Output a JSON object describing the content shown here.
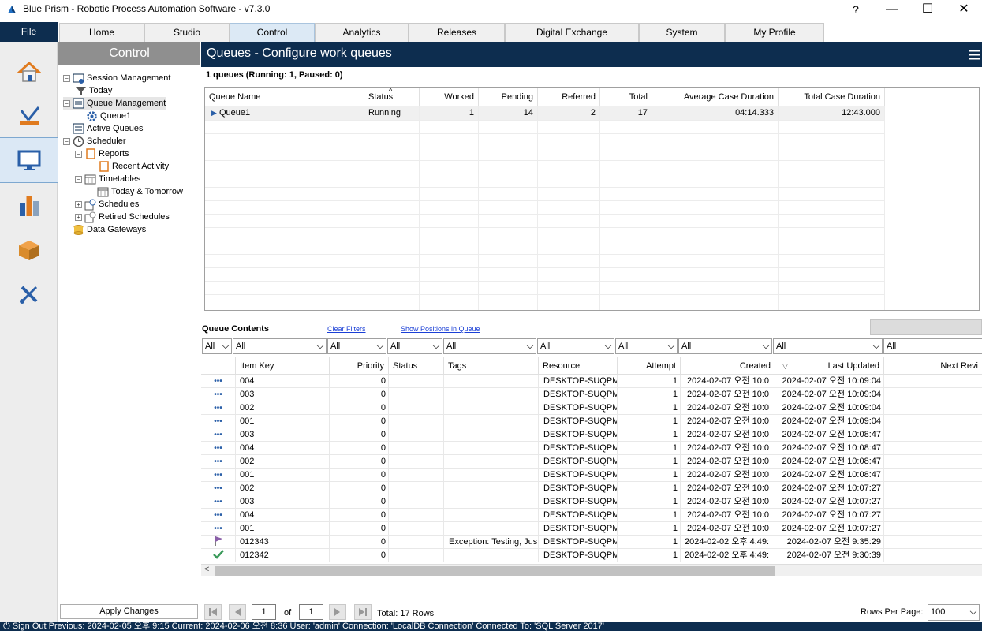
{
  "window": {
    "title": "Blue Prism - Robotic Process Automation Software - v7.3.0",
    "help": "?",
    "minimize": "—",
    "maximize": "☐",
    "close": "✕"
  },
  "menu": {
    "file": "File",
    "tabs": [
      "Home",
      "Studio",
      "Control",
      "Analytics",
      "Releases",
      "Digital Exchange",
      "System",
      "My Profile"
    ],
    "active_tab": "Control"
  },
  "iconbar": {
    "items": [
      "home-icon",
      "studio-icon",
      "control-icon",
      "analytics-icon",
      "releases-icon",
      "system-icon"
    ],
    "active": "control-icon"
  },
  "nav": {
    "title": "Control",
    "tree": [
      {
        "label": "Session Management",
        "icon": "session-management-icon"
      },
      {
        "label": "Today",
        "icon": "filter-icon"
      },
      {
        "label": "Queue Management",
        "icon": "queue-management-icon"
      },
      {
        "label": "Queue1",
        "icon": "gear-icon"
      },
      {
        "label": "Active Queues",
        "icon": "active-queues-icon"
      },
      {
        "label": "Scheduler",
        "icon": "clock-icon"
      },
      {
        "label": "Reports",
        "icon": "report-icon"
      },
      {
        "label": "Recent Activity",
        "icon": "report-icon"
      },
      {
        "label": "Timetables",
        "icon": "calendar-icon"
      },
      {
        "label": "Today & Tomorrow",
        "icon": "calendar-icon"
      },
      {
        "label": "Schedules",
        "icon": "schedule-icon"
      },
      {
        "label": "Retired Schedules",
        "icon": "retired-schedule-icon"
      },
      {
        "label": "Data Gateways",
        "icon": "data-gateway-icon"
      }
    ],
    "apply": "Apply Changes"
  },
  "main": {
    "title": "Queues - Configure work queues",
    "summary": "1 queues (Running: 1, Paused: 0)",
    "queue_columns": [
      "Queue Name",
      "Status",
      "Worked",
      "Pending",
      "Referred",
      "Total",
      "Average Case Duration",
      "Total Case Duration"
    ],
    "queue_rows": [
      [
        "Queue1",
        "Running",
        "1",
        "14",
        "2",
        "17",
        "04:14.333",
        "12:43.000"
      ]
    ],
    "contents_title": "Queue Contents",
    "clear_filters": "Clear Filters",
    "show_positions": "Show Positions in Queue",
    "filters": [
      "All",
      "All",
      "All",
      "All",
      "All",
      "All",
      "All",
      "All",
      "All",
      "All"
    ],
    "content_columns": [
      "Item Key",
      "Priority",
      "Status",
      "Tags",
      "Resource",
      "Attempt",
      "Created",
      "Last Updated",
      "Next Revi"
    ],
    "content_rows": [
      {
        "icon": "dots",
        "key": "004",
        "priority": "0",
        "status": "",
        "tags": "",
        "resource": "DESKTOP-SUQPM",
        "attempt": "1",
        "created": "2024-02-07 오전 10:0",
        "updated": "2024-02-07 오전 10:09:04"
      },
      {
        "icon": "dots",
        "key": "003",
        "priority": "0",
        "status": "",
        "tags": "",
        "resource": "DESKTOP-SUQPM",
        "attempt": "1",
        "created": "2024-02-07 오전 10:0",
        "updated": "2024-02-07 오전 10:09:04"
      },
      {
        "icon": "dots",
        "key": "002",
        "priority": "0",
        "status": "",
        "tags": "",
        "resource": "DESKTOP-SUQPM",
        "attempt": "1",
        "created": "2024-02-07 오전 10:0",
        "updated": "2024-02-07 오전 10:09:04"
      },
      {
        "icon": "dots",
        "key": "001",
        "priority": "0",
        "status": "",
        "tags": "",
        "resource": "DESKTOP-SUQPM",
        "attempt": "1",
        "created": "2024-02-07 오전 10:0",
        "updated": "2024-02-07 오전 10:09:04"
      },
      {
        "icon": "dots",
        "key": "003",
        "priority": "0",
        "status": "",
        "tags": "",
        "resource": "DESKTOP-SUQPM",
        "attempt": "1",
        "created": "2024-02-07 오전 10:0",
        "updated": "2024-02-07 오전 10:08:47"
      },
      {
        "icon": "dots",
        "key": "004",
        "priority": "0",
        "status": "",
        "tags": "",
        "resource": "DESKTOP-SUQPM",
        "attempt": "1",
        "created": "2024-02-07 오전 10:0",
        "updated": "2024-02-07 오전 10:08:47"
      },
      {
        "icon": "dots",
        "key": "002",
        "priority": "0",
        "status": "",
        "tags": "",
        "resource": "DESKTOP-SUQPM",
        "attempt": "1",
        "created": "2024-02-07 오전 10:0",
        "updated": "2024-02-07 오전 10:08:47"
      },
      {
        "icon": "dots",
        "key": "001",
        "priority": "0",
        "status": "",
        "tags": "",
        "resource": "DESKTOP-SUQPM",
        "attempt": "1",
        "created": "2024-02-07 오전 10:0",
        "updated": "2024-02-07 오전 10:08:47"
      },
      {
        "icon": "dots",
        "key": "002",
        "priority": "0",
        "status": "",
        "tags": "",
        "resource": "DESKTOP-SUQPM",
        "attempt": "1",
        "created": "2024-02-07 오전 10:0",
        "updated": "2024-02-07 오전 10:07:27"
      },
      {
        "icon": "dots",
        "key": "003",
        "priority": "0",
        "status": "",
        "tags": "",
        "resource": "DESKTOP-SUQPM",
        "attempt": "1",
        "created": "2024-02-07 오전 10:0",
        "updated": "2024-02-07 오전 10:07:27"
      },
      {
        "icon": "dots",
        "key": "004",
        "priority": "0",
        "status": "",
        "tags": "",
        "resource": "DESKTOP-SUQPM",
        "attempt": "1",
        "created": "2024-02-07 오전 10:0",
        "updated": "2024-02-07 오전 10:07:27"
      },
      {
        "icon": "dots",
        "key": "001",
        "priority": "0",
        "status": "",
        "tags": "",
        "resource": "DESKTOP-SUQPM",
        "attempt": "1",
        "created": "2024-02-07 오전 10:0",
        "updated": "2024-02-07 오전 10:07:27"
      },
      {
        "icon": "flag",
        "key": "012343",
        "priority": "0",
        "status": "",
        "tags": "Exception: Testing, Jus",
        "resource": "DESKTOP-SUQPM",
        "attempt": "1",
        "created": "2024-02-02 오후 4:49:",
        "updated": "2024-02-07 오전 9:35:29"
      },
      {
        "icon": "check",
        "key": "012342",
        "priority": "0",
        "status": "",
        "tags": "",
        "resource": "DESKTOP-SUQPM",
        "attempt": "1",
        "created": "2024-02-02 오후 4:49:",
        "updated": "2024-02-07 오전 9:30:39"
      }
    ],
    "pager": {
      "page": "1",
      "of": "of",
      "total_pages": "1",
      "total": "Total: 17 Rows",
      "rows_label": "Rows Per Page:",
      "rows_value": "100"
    }
  },
  "status": "Sign Out  Previous: 2024-02-05 오후 9:15  Current: 2024-02-06 오전 8:36  User: 'admin'  Connection: 'LocalDB Connection'  Connected To: 'SQL Server 2017'",
  "colors": {
    "navy": "#0d2d4f",
    "accent": "#2a5fa8",
    "panel_gray": "#8f8f8f"
  }
}
